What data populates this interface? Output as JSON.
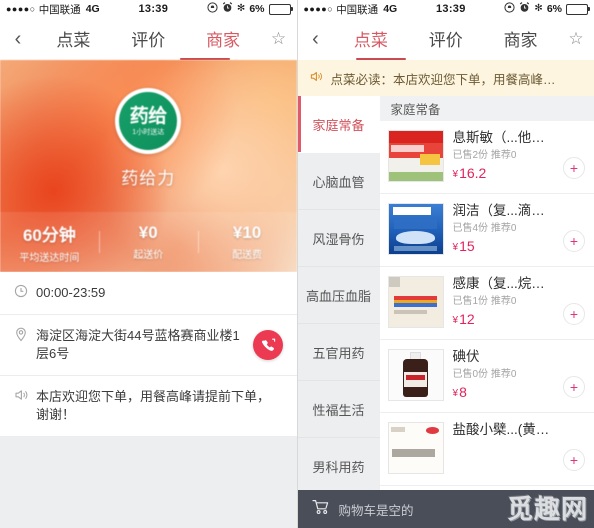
{
  "status_bar": {
    "signal_dots": "●●●●○",
    "carrier": "中国联通",
    "network": "4G",
    "time": "13:39",
    "rotation_lock_icon": "rotation-lock-icon",
    "alarm_icon": "alarm-icon",
    "bluetooth_glyph": "✻",
    "battery_percent": "6%"
  },
  "left_panel": {
    "nav": {
      "back_glyph": "‹",
      "tabs": [
        {
          "label": "点菜",
          "active": false
        },
        {
          "label": "评价",
          "active": false
        },
        {
          "label": "商家",
          "active": true
        }
      ],
      "star_glyph": "☆"
    },
    "hero": {
      "logo_main": "药给",
      "logo_sub": "1小时送达",
      "shop_name": "药给力",
      "stats": [
        {
          "value": "60分钟",
          "label": "平均送达时间"
        },
        {
          "value": "¥0",
          "label": "起送价"
        },
        {
          "value": "¥10",
          "label": "配送费"
        }
      ]
    },
    "info_rows": [
      {
        "icon": "clock-icon",
        "glyph": "◷",
        "text": "00:00-23:59",
        "has_call": false
      },
      {
        "icon": "location-icon",
        "glyph": "◎",
        "text": "海淀区海淀大街44号蓝格赛商业楼1层6号",
        "has_call": true
      },
      {
        "icon": "announcement-icon",
        "glyph": "◁))",
        "text": "本店欢迎您下单，用餐高峰请提前下单，谢谢！",
        "has_call": false
      }
    ],
    "call_button_glyph": "℘"
  },
  "right_panel": {
    "nav": {
      "back_glyph": "‹",
      "tabs": [
        {
          "label": "点菜",
          "active": true
        },
        {
          "label": "评价",
          "active": false
        },
        {
          "label": "商家",
          "active": false
        }
      ],
      "star_glyph": "☆"
    },
    "notice": {
      "icon": "announcement-icon",
      "glyph": "◁))",
      "text": "点菜必读：本店欢迎您下单，用餐高峰…"
    },
    "categories": [
      {
        "label": "家庭常备",
        "active": true
      },
      {
        "label": "心脑血管",
        "active": false
      },
      {
        "label": "风湿骨伤",
        "active": false
      },
      {
        "label": "高血压血脂",
        "active": false
      },
      {
        "label": "五官用药",
        "active": false
      },
      {
        "label": "性福生活",
        "active": false
      },
      {
        "label": "男科用药",
        "active": false
      }
    ],
    "list_header": "家庭常备",
    "items": [
      {
        "name": "息斯敏（...他定片）",
        "meta": "已售2份 推荐0",
        "yen": "¥",
        "price": "16.2",
        "thumb": "red-box",
        "add_glyph": "+"
      },
      {
        "name": "润洁（复...滴眼液）",
        "meta": "已售4份 推荐0",
        "yen": "¥",
        "price": "15",
        "thumb": "blue-box",
        "add_glyph": "+"
      },
      {
        "name": "感康（复...烷胺片）",
        "meta": "已售1份 推荐0",
        "yen": "¥",
        "price": "12",
        "thumb": "cream-box",
        "add_glyph": "+"
      },
      {
        "name": "碘伏",
        "meta": "已售0份 推荐0",
        "yen": "¥",
        "price": "8",
        "thumb": "bottle",
        "add_glyph": "+"
      },
      {
        "name": "盐酸小檗...(黄连素)",
        "meta": "",
        "yen": "",
        "price": "",
        "thumb": "white-box",
        "add_glyph": "+"
      }
    ],
    "cart": {
      "icon": "cart-icon",
      "glyph": "🛒",
      "text": "购物车是空的",
      "watermark": "觅趣网"
    }
  },
  "colors": {
    "accent_red": "#d65a63",
    "price_red": "#e0245e",
    "call_red": "#ec3a52",
    "notice_bg": "#fdf5e0",
    "cart_bg": "#4a4e58",
    "cat_bg": "#eceef0"
  }
}
